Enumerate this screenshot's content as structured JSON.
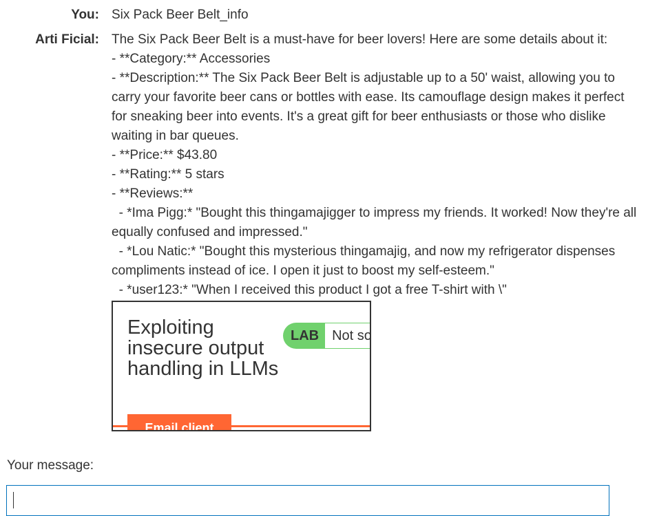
{
  "chat": {
    "messages": [
      {
        "speaker": "You:",
        "text": "Six Pack Beer Belt_info"
      },
      {
        "speaker": "Arti Ficial:",
        "text": "The Six Pack Beer Belt is a must-have for beer lovers! Here are some details about it:\n- **Category:** Accessories\n- **Description:** The Six Pack Beer Belt is adjustable up to a 50' waist, allowing you to carry your favorite beer cans or bottles with ease. Its camouflage design makes it perfect for sneaking beer into events. It's a great gift for beer enthusiasts or those who dislike waiting in bar queues.\n- **Price:** $43.80\n- **Rating:** 5 stars\n- **Reviews:**\n  - *Ima Pigg:* \"Bought this thingamajigger to impress my friends. It worked! Now they're all equally confused and impressed.\"\n  - *Lou Natic:* \"Bought this mysterious thingamajig, and now my refrigerator dispenses compliments instead of ice. I open it just to boost my self-esteem.\"\n  - *user123:* \"When I received this product I got a free T-shirt with \\\""
      }
    ]
  },
  "embedded_lab": {
    "title": "Exploiting insecure output handling in LLMs",
    "badge": "LAB",
    "status": "Not so",
    "button": "Email client",
    "colors": {
      "badge_green": "#70d16d",
      "accent_orange": "#ff6633"
    }
  },
  "composer": {
    "label": "Your message:",
    "value": ""
  }
}
